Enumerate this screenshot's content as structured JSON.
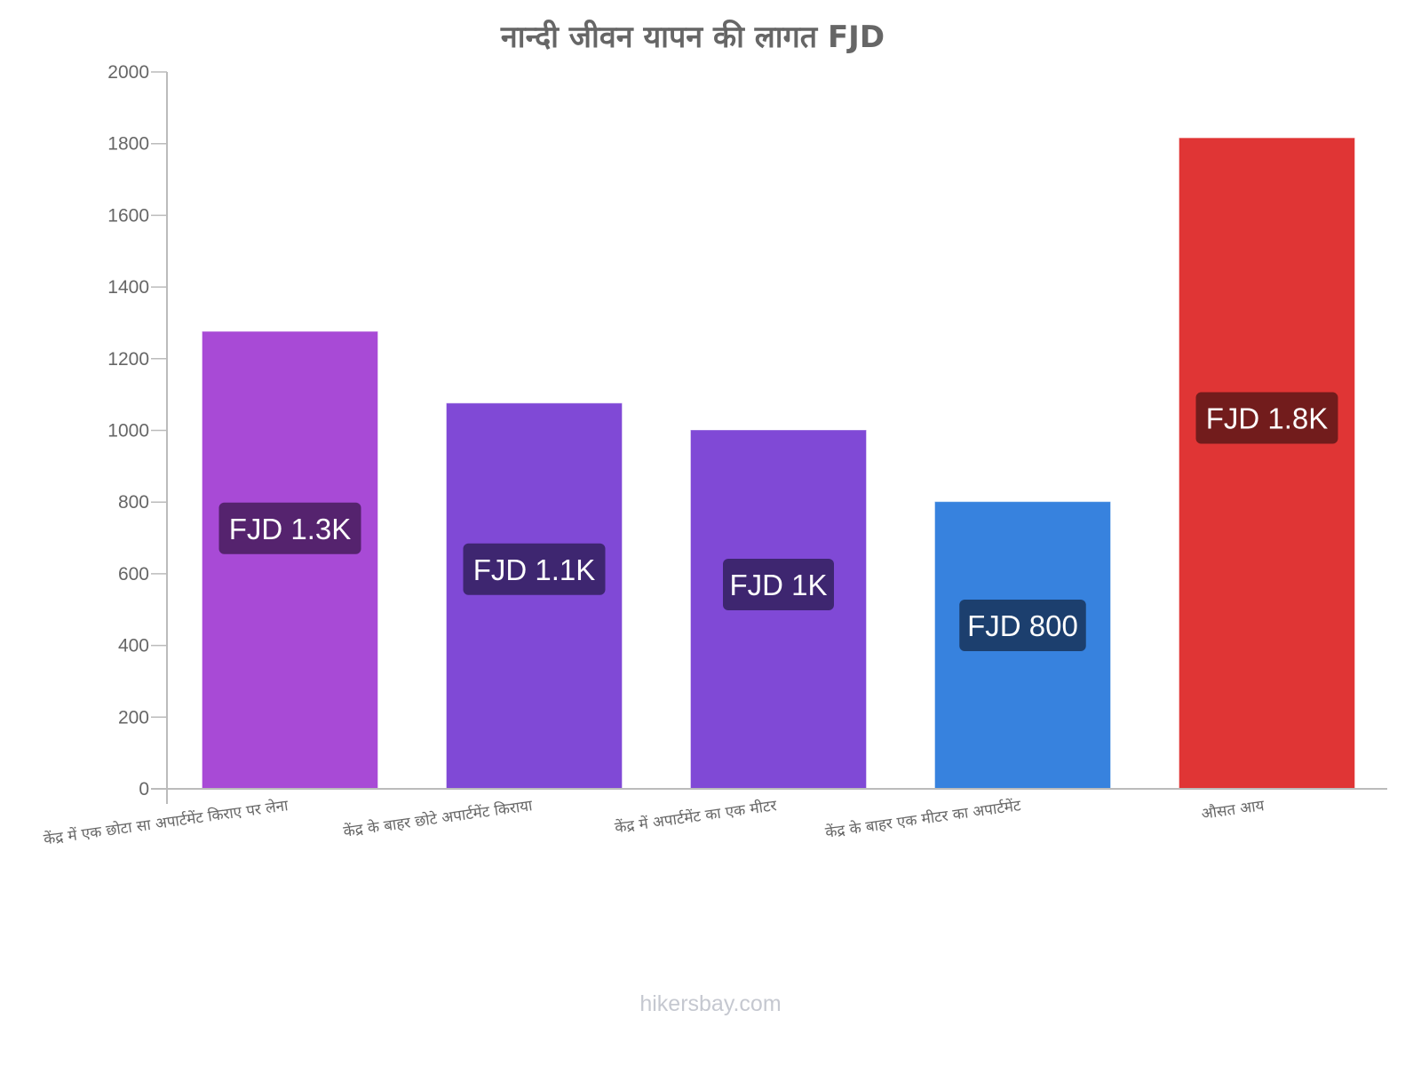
{
  "chart_data": {
    "type": "bar",
    "title": "नान्दी   जीवन   यापन   की   लागत   FJD",
    "xlabel": "",
    "ylabel": "",
    "ylim": [
      0,
      2000
    ],
    "yticks": [
      0,
      200,
      400,
      600,
      800,
      1000,
      1200,
      1400,
      1600,
      1800,
      2000
    ],
    "grid": false,
    "categories": [
      "केंद्र में एक छोटा सा अपार्टमेंट किराए पर लेना",
      "केंद्र के बाहर छोटे अपार्टमेंट किराया",
      "केंद्र में अपार्टमेंट का एक मीटर",
      "केंद्र के बाहर एक मीटर का अपार्टमेंट",
      "औसत आय"
    ],
    "values": [
      1275,
      1075,
      1000,
      800,
      1815
    ],
    "data_labels": [
      "FJD 1.3K",
      "FJD 1.1K",
      "FJD 1K",
      "FJD 800",
      "FJD 1.8K"
    ],
    "colors": [
      "#a84ad6",
      "#8049d6",
      "#8049d6",
      "#3782de",
      "#e03535"
    ],
    "label_bg_colors": [
      "#55236e",
      "#3e2670",
      "#3e2670",
      "#1c3f6e",
      "#721c1c"
    ]
  },
  "footer": {
    "watermark": "hikersbay.com"
  }
}
